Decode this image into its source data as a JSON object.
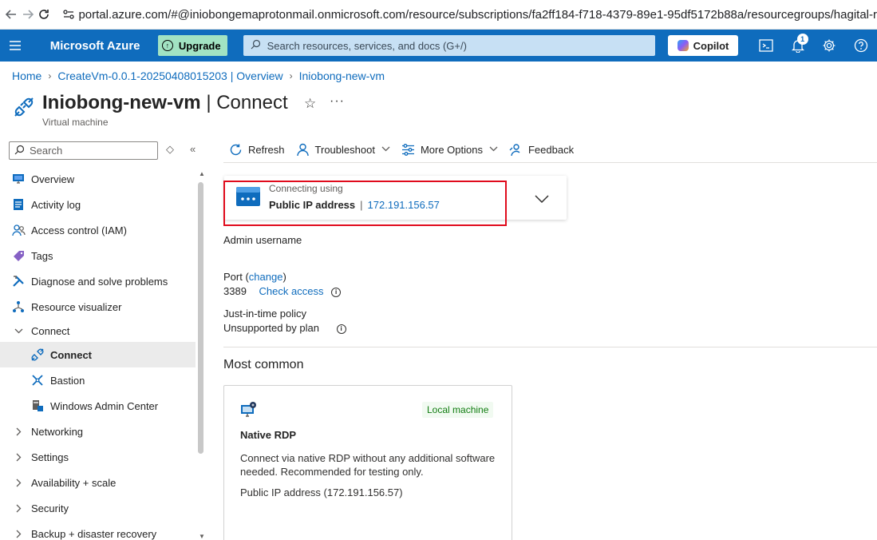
{
  "browser": {
    "url": "portal.azure.com/#@iniobongemaprotonmail.onmicrosoft.com/resource/subscriptions/fa2ff184-f718-4379-89e1-95df5172b88a/resourcegroups/hagital-r"
  },
  "topbar": {
    "brand": "Microsoft Azure",
    "upgrade_label": "Upgrade",
    "search_placeholder": "Search resources, services, and docs (G+/)",
    "copilot_label": "Copilot",
    "notification_count": "1",
    "bg_color": "#0f6cbd"
  },
  "breadcrumb": {
    "items": [
      "Home",
      "CreateVm-0.0.1-20250408015203 | Overview",
      "Iniobong-new-vm"
    ]
  },
  "header": {
    "title_bold": "Iniobong-new-vm",
    "title_rest": " | Connect",
    "subtitle": "Virtual machine"
  },
  "sidebar": {
    "search_placeholder": "Search",
    "items": [
      {
        "label": "Overview",
        "icon": "monitor-icon"
      },
      {
        "label": "Activity log",
        "icon": "log-icon"
      },
      {
        "label": "Access control (IAM)",
        "icon": "people-icon"
      },
      {
        "label": "Tags",
        "icon": "tag-icon"
      },
      {
        "label": "Diagnose and solve problems",
        "icon": "wrench-icon"
      },
      {
        "label": "Resource visualizer",
        "icon": "network-icon"
      },
      {
        "label": "Connect",
        "icon": "chevron-down-icon"
      },
      {
        "label": "Connect",
        "icon": "connect-icon"
      },
      {
        "label": "Bastion",
        "icon": "bastion-icon"
      },
      {
        "label": "Windows Admin Center",
        "icon": "admin-center-icon"
      },
      {
        "label": "Networking",
        "icon": "chevron-right-icon"
      },
      {
        "label": "Settings",
        "icon": "chevron-right-icon"
      },
      {
        "label": "Availability + scale",
        "icon": "chevron-right-icon"
      },
      {
        "label": "Security",
        "icon": "chevron-right-icon"
      },
      {
        "label": "Backup + disaster recovery",
        "icon": "chevron-right-icon"
      }
    ]
  },
  "toolbar": {
    "refresh": "Refresh",
    "troubleshoot": "Troubleshoot",
    "more_options": "More Options",
    "feedback": "Feedback"
  },
  "connection": {
    "label": "Connecting using",
    "method": "Public IP address",
    "ip": "172.191.156.57",
    "admin_username_label": "Admin username",
    "port_label": "Port (",
    "port_change": "change",
    "port_close": ")",
    "port_value": "3389",
    "check_access": "Check access",
    "jit_label": "Just-in-time policy",
    "jit_value": "Unsupported by plan"
  },
  "most_common": {
    "title": "Most common",
    "card": {
      "badge": "Local machine",
      "title": "Native RDP",
      "description": "Connect via native RDP without any additional software needed. Recommended for testing only.",
      "ip_text": "Public IP address (172.191.156.57)"
    }
  }
}
